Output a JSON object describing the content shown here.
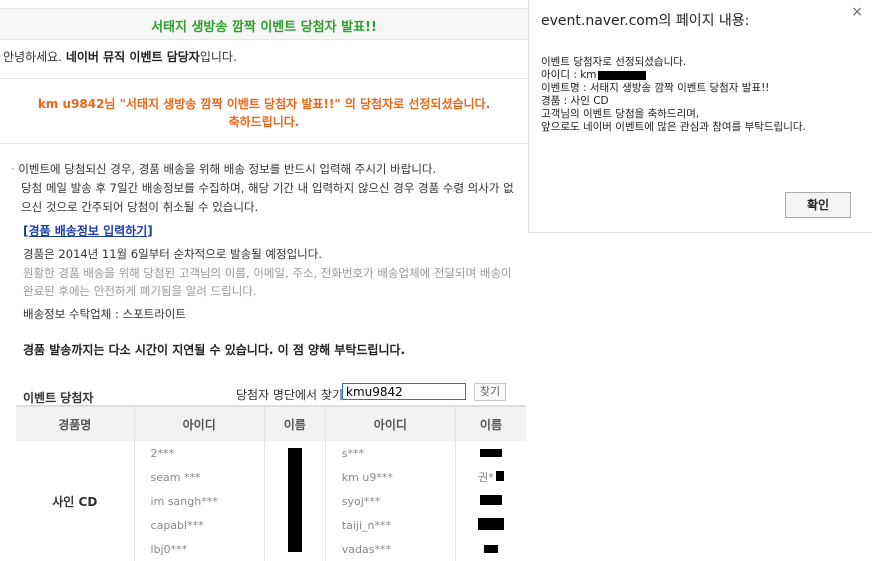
{
  "page": {
    "title": "서태지 생방송 깜짝 이벤트 당첨자 발표!!",
    "greeting_prefix": "안녕하세요. ",
    "greeting_bold": "네이버 뮤직 이벤트 담당자",
    "greeting_suffix": "입니다.",
    "winner_line1": "km u9842님 \"서태지 생방송 깜짝 이벤트 당첨자 발표!!\" 의 당첨자로 선정되셨습니다.",
    "winner_line2": "축하드립니다.",
    "notice_line1": "이벤트에 당첨되신 경우, 경품 배송을 위해 배송 정보를 반드시 입력해 주시기 바랍니다.",
    "notice_line2": "당첨 메일 발송 후 7일간 배송정보를 수집하며, 해당 기간 내 입력하지 않으신 경우 경품 수령 의사가 없으신 것으로 간주되어 당첨이 취소될 수 있습니다.",
    "shipping_link": "[경품 배송정보 입력하기]",
    "shipping_date": "경품은 2014년 11월 6일부터 순차적으로 발송될 예정입니다.",
    "shipping_privacy": "원활한 경품 배송을 위해 당첨된 고객님의 이름, 이메일, 주소, 전화번호가 배송업체에 전달되며 배송이 완료된 후에는 안전하게 폐기됨을 알려 드립니다.",
    "company": "배송정보 수탁업체 : 스포트라이트",
    "delay": "경품 발송까지는 다소 시간이 지연될 수 있습니다. 이 점 양해 부탁드립니다.",
    "winners_title": "이벤트 당첨자",
    "search_label": "당첨자 명단에서 찾기",
    "search_value": "kmu9842",
    "search_button": "찾기"
  },
  "table": {
    "headers": [
      "경품명",
      "아이디",
      "이름",
      "아이디",
      "이름"
    ],
    "prize": "사인 CD",
    "rows": [
      {
        "id1": "2***",
        "name1": "",
        "id2": "s***",
        "name2": ""
      },
      {
        "id1": "seam ***",
        "name1": "",
        "id2": "km u9***",
        "name2": "권*"
      },
      {
        "id1": "im sangh***",
        "name1": "",
        "id2": "syoj***",
        "name2": ""
      },
      {
        "id1": "capabl***",
        "name1": "",
        "id2": "taiji_n***",
        "name2": ""
      },
      {
        "id1": "lbj0***",
        "name1": "",
        "id2": "vadas***",
        "name2": ""
      }
    ]
  },
  "dialog": {
    "title": "event.naver.com의 페이지 내용:",
    "close": "×",
    "lines": [
      "이벤트 당첨자로 선정되셨습니다.",
      "아이디 : km",
      "이벤트명 : 서태지 생방송 깜짝 이벤트 당첨자 발표!!",
      "경품 : 사인 CD",
      "고객님의 이벤트 당첨을 축하드리며,",
      "앞으로도 네이버 이벤트에 많은 관심과 참여를 부탁드립니다."
    ],
    "ok": "확인"
  }
}
